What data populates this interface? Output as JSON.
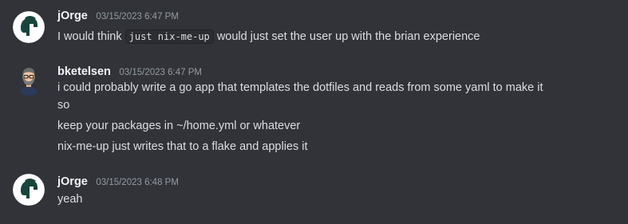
{
  "messages": [
    {
      "username": "jOrge",
      "timestamp": "03/15/2023 6:47 PM",
      "avatar_icon": "spartan-helmet-icon",
      "avatar_colors": {
        "bg": "#ffffff",
        "fg": "#18453b"
      },
      "lines": [
        {
          "before": "I would think ",
          "code": "just nix-me-up",
          "after": " would just set the user up with the brian experience"
        }
      ]
    },
    {
      "username": "bketelsen",
      "timestamp": "03/15/2023 6:47 PM",
      "avatar_icon": "bearded-man-avatar-icon",
      "avatar_colors": {
        "bg": "#313338",
        "skin": "#f1c3a0",
        "hair": "#6b6b6b",
        "shirt": "#2b3a5a"
      },
      "lines": [
        {
          "text": "i could probably write a go app that templates the dotfiles and reads from some yaml to make it"
        },
        {
          "text": "so"
        },
        {
          "text": "keep your packages in ~/home.yml or whatever"
        },
        {
          "text": "nix-me-up just writes that to a flake and applies it"
        }
      ]
    },
    {
      "username": "jOrge",
      "timestamp": "03/15/2023 6:48 PM",
      "avatar_icon": "spartan-helmet-icon",
      "avatar_colors": {
        "bg": "#ffffff",
        "fg": "#18453b"
      },
      "lines": [
        {
          "text": "yeah"
        }
      ]
    }
  ]
}
